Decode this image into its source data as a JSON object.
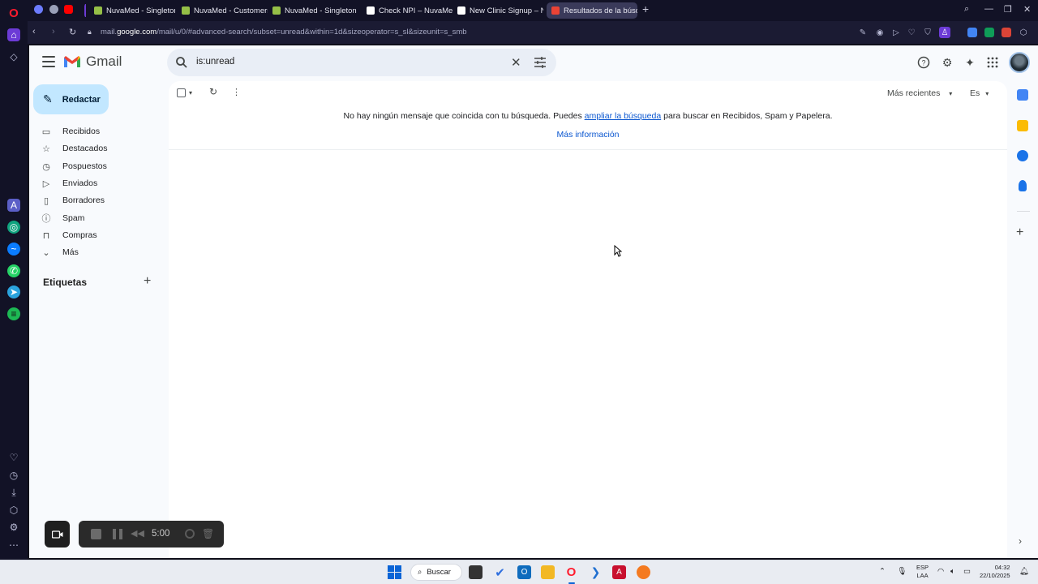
{
  "browser": {
    "tabs": [
      {
        "label": "NuvaMed - Singleton | Ve"
      },
      {
        "label": "NuvaMed - Customers - S"
      },
      {
        "label": "NuvaMed - Singleton | Ve"
      },
      {
        "label": "Check NPI – NuvaMed"
      },
      {
        "label": "New Clinic Signup – Nuva"
      },
      {
        "label": "Resultados de la búsq"
      }
    ],
    "url_prefix": "mail.",
    "url_domain": "google.com",
    "url_rest": "/mail/u/0/#advanced-search/subset=unread&within=1d&sizeoperator=s_sl&sizeunit=s_smb"
  },
  "gmail": {
    "logo_text": "Gmail",
    "search_value": "is:unread",
    "compose_label": "Redactar",
    "nav": [
      {
        "label": "Recibidos",
        "icon": "inbox-icon"
      },
      {
        "label": "Destacados",
        "icon": "star-icon"
      },
      {
        "label": "Pospuestos",
        "icon": "clock-icon"
      },
      {
        "label": "Enviados",
        "icon": "send-icon"
      },
      {
        "label": "Borradores",
        "icon": "draft-icon"
      },
      {
        "label": "Spam",
        "icon": "spam-icon"
      },
      {
        "label": "Compras",
        "icon": "shopping-bag-icon"
      },
      {
        "label": "Más",
        "icon": "chevron-down-icon"
      }
    ],
    "labels_heading": "Etiquetas",
    "sort_label": "Más recientes",
    "lang_label": "Es",
    "empty_message_pre": "No hay ningún mensaje que coincida con tu búsqueda. Puedes ",
    "empty_message_link": "ampliar la búsqueda",
    "empty_message_post": " para buscar en Recibidos, Spam y Papelera.",
    "more_info": "Más información"
  },
  "recorder": {
    "time": "5:00"
  },
  "taskbar": {
    "search_label": "Buscar",
    "lang_top": "ESP",
    "lang_bottom": "LAA",
    "time": "04:32",
    "date": "22/10/2025"
  },
  "colors": {
    "compose_bg": "#c2e7ff",
    "link": "#0b57d0",
    "opera_red": "#ff1b2d"
  }
}
